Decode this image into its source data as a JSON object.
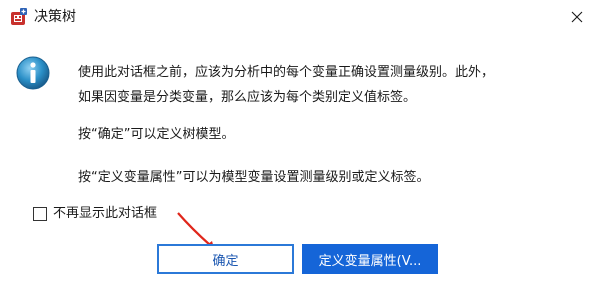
{
  "window": {
    "title": "决策树",
    "close_glyph": "✕"
  },
  "message": {
    "line1": "使用此对话框之前，应该为分析中的每个变量正确设置测量级别。此外，",
    "line2": "如果因变量是分类变量，那么应该为每个类别定义值标签。",
    "line3": "按“确定”可以定义树模型。",
    "line4": "按“定义变量属性”可以为模型变量设置测量级别或定义标签。"
  },
  "checkbox": {
    "label": "不再显示此对话框",
    "checked": false
  },
  "buttons": {
    "ok_label": "确定",
    "define_label": "定义变量属性(V..."
  },
  "icons": {
    "app": "spss-app-icon",
    "info": "info-icon",
    "close": "close-icon",
    "annotation": "red-arrow-annotation"
  },
  "colors": {
    "primary_button": "#1565d8",
    "ok_border": "#2b79d8",
    "info_icon": "#2a8fc7",
    "arrow": "#e0261b"
  }
}
